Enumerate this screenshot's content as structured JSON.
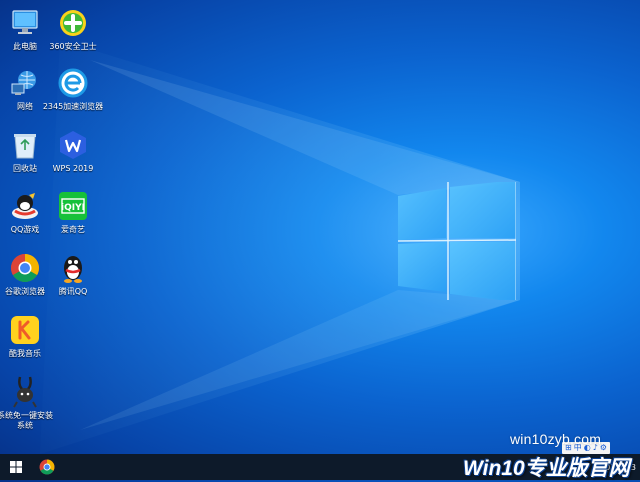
{
  "desktop": {
    "icons": [
      {
        "label": "此电脑",
        "icon": "computer-icon"
      },
      {
        "label": "360安全卫士",
        "icon": "security-guard-icon"
      },
      {
        "label": "网络",
        "icon": "network-icon"
      },
      {
        "label": "2345加速浏览器",
        "icon": "browser-e-icon"
      },
      {
        "label": "回收站",
        "icon": "recycle-bin-icon"
      },
      {
        "label": "WPS 2019",
        "icon": "wps-icon"
      },
      {
        "label": "QQ游戏",
        "icon": "qq-game-icon"
      },
      {
        "label": "爱奇艺",
        "icon": "iqiyi-icon"
      },
      {
        "label": "谷歌浏览器",
        "icon": "chrome-icon"
      },
      {
        "label": "腾讯QQ",
        "icon": "qq-penguin-icon"
      },
      {
        "label": "酷我音乐",
        "icon": "kuwo-music-icon"
      },
      {
        "label": "系统免一键安装系统",
        "icon": "rabbit-installer-icon"
      }
    ]
  },
  "watermark": {
    "site": "win10zyb.com",
    "brand": "Win10专业版官网"
  },
  "taskbar": {
    "start_icon": "windows-start-icon",
    "pinned": [
      {
        "icon": "chrome-icon"
      }
    ],
    "ime_label": "中",
    "ime_glyph": "♪",
    "clock_date": "2021/1/3"
  }
}
